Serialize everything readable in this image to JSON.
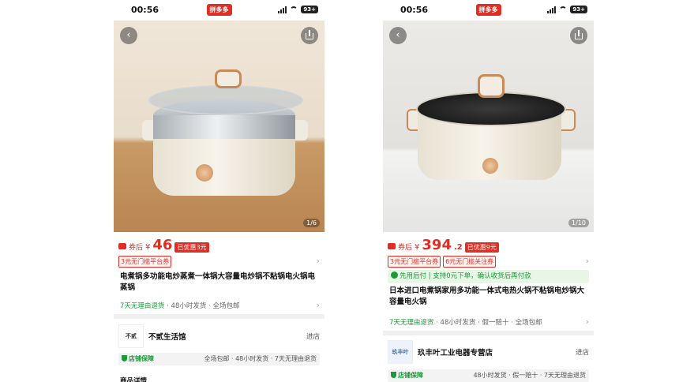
{
  "screens": [
    {
      "status_time": "00:56",
      "brand": "拼多多",
      "battery": "93+",
      "page_indicator": "1/6",
      "after_coupon": "券后",
      "currency": "¥",
      "price": "46",
      "price_decimal": "",
      "discount": "已优惠3元",
      "coupons": [
        "3元无门槛平台券"
      ],
      "pay_later": "",
      "title": "电煮锅多功能电炒蒸煮一体锅大容量电炒锅不粘锅电火锅电蒸锅",
      "services": [
        "7天无理由退货",
        "48小时发货",
        "全场包邮"
      ],
      "store_logo": "不贰",
      "store_name": "不贰生活馆",
      "enter_store": "进店",
      "guarantee_label": "店铺保障",
      "guarantee_items": "全场包邮 · 48小时发货 · 7天无理由退货",
      "more_label": "商品详情"
    },
    {
      "status_time": "00:56",
      "brand": "拼多多",
      "battery": "93+",
      "page_indicator": "1/10",
      "after_coupon": "券后",
      "currency": "¥",
      "price": "394",
      "price_decimal": ".2",
      "discount": "已优惠9元",
      "coupons": [
        "3元无门槛平台券",
        "6元无门槛关注券"
      ],
      "pay_later": "先用后付 | 支持0元下单，确认收货后再付款",
      "title": "日本进口电煮锅家用多功能一体式电热火锅不粘锅电炒锅大容量电火锅",
      "services": [
        "7天无理由退货",
        "48小时发货",
        "假一赔十",
        "全场包邮"
      ],
      "store_logo": "玖丰叶",
      "store_name": "玖丰叶工业电器专营店",
      "enter_store": "进店",
      "guarantee_label": "店铺保障",
      "guarantee_items": "48小时发货 · 假一赔十 · 7天无理由退货",
      "more_label": ""
    }
  ],
  "colors": {
    "accent": "#e02e24",
    "green": "#1b9b3a"
  }
}
